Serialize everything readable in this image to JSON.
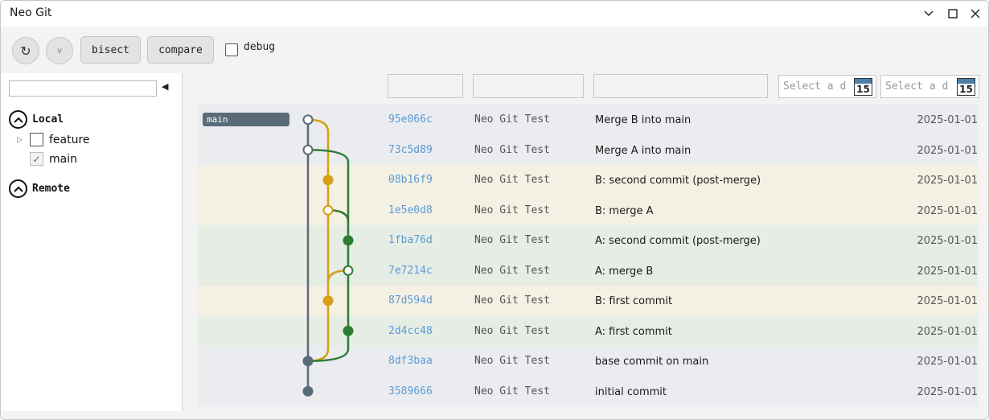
{
  "window": {
    "title": "Neo Git"
  },
  "toolbar": {
    "refresh_glyph": "↻",
    "branch_glyph": "⑂",
    "bisect_label": "bisect",
    "compare_label": "compare",
    "debug_label": "debug",
    "debug_checked": false
  },
  "sidebar": {
    "collapse_glyph": "◀",
    "local_label": "Local",
    "remote_label": "Remote",
    "local_branches": [
      {
        "name": "feature",
        "checked": false,
        "has_children": true
      },
      {
        "name": "main",
        "checked": true,
        "has_children": false
      }
    ]
  },
  "filters": {
    "date_from_placeholder": "Select a d",
    "date_to_placeholder": "Select a d",
    "calendar_day": "15"
  },
  "colors": {
    "main_lane": "#5a6b78",
    "branch_b": "#d4a017",
    "branch_a": "#2e7d32",
    "hash": "#5b9bd5",
    "row_main": "#ebecef",
    "row_b": "#f4f0e4",
    "row_a": "#e6ede5"
  },
  "commits": [
    {
      "hash": "95e066c",
      "author": "Neo Git Test",
      "message": "Merge B into main",
      "date": "2025-01-01",
      "branch_tag": "main",
      "lane": "main"
    },
    {
      "hash": "73c5d89",
      "author": "Neo Git Test",
      "message": "Merge A into main",
      "date": "2025-01-01",
      "branch_tag": "",
      "lane": "main"
    },
    {
      "hash": "08b16f9",
      "author": "Neo Git Test",
      "message": "B: second commit (post-merge)",
      "date": "2025-01-01",
      "branch_tag": "",
      "lane": "b"
    },
    {
      "hash": "1e5e0d8",
      "author": "Neo Git Test",
      "message": "B: merge A",
      "date": "2025-01-01",
      "branch_tag": "",
      "lane": "b"
    },
    {
      "hash": "1fba76d",
      "author": "Neo Git Test",
      "message": "A: second commit (post-merge)",
      "date": "2025-01-01",
      "branch_tag": "",
      "lane": "a"
    },
    {
      "hash": "7e7214c",
      "author": "Neo Git Test",
      "message": "A: merge B",
      "date": "2025-01-01",
      "branch_tag": "",
      "lane": "a"
    },
    {
      "hash": "87d594d",
      "author": "Neo Git Test",
      "message": "B: first commit",
      "date": "2025-01-01",
      "branch_tag": "",
      "lane": "b"
    },
    {
      "hash": "2d4cc48",
      "author": "Neo Git Test",
      "message": "A: first commit",
      "date": "2025-01-01",
      "branch_tag": "",
      "lane": "a"
    },
    {
      "hash": "8df3baa",
      "author": "Neo Git Test",
      "message": "base commit on main",
      "date": "2025-01-01",
      "branch_tag": "",
      "lane": "main"
    },
    {
      "hash": "3589666",
      "author": "Neo Git Test",
      "message": "initial commit",
      "date": "2025-01-01",
      "branch_tag": "",
      "lane": "main"
    }
  ]
}
